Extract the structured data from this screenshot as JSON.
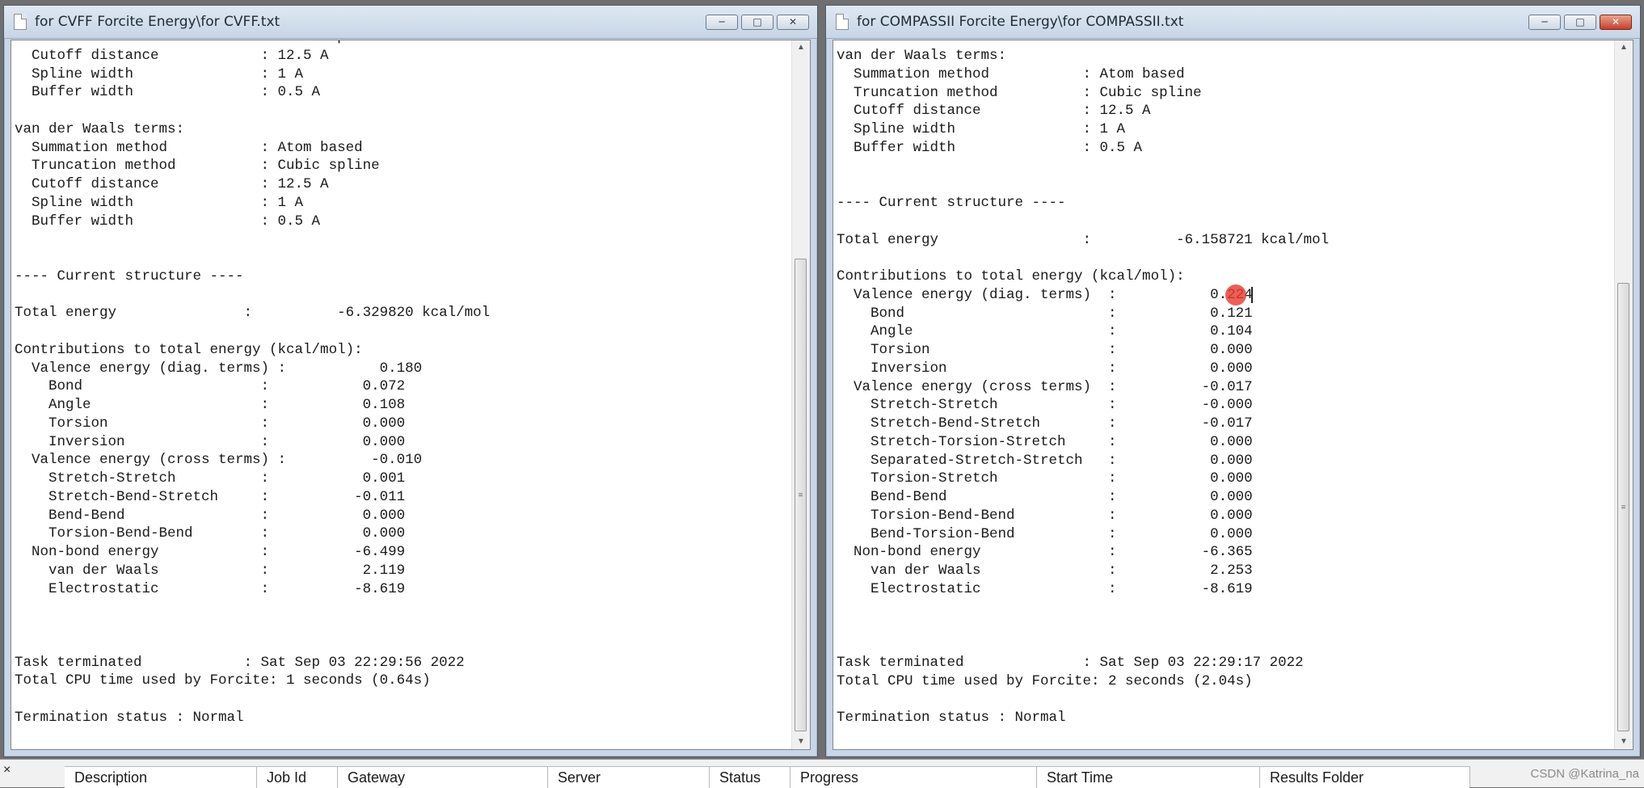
{
  "left_window": {
    "title": "for CVFF Forcite Energy\\for CVFF.txt",
    "text": "  Truncation method          : Cubic spline\n  Cutoff distance            : 12.5 A\n  Spline width               : 1 A\n  Buffer width               : 0.5 A\n\nvan der Waals terms:\n  Summation method           : Atom based\n  Truncation method          : Cubic spline\n  Cutoff distance            : 12.5 A\n  Spline width               : 1 A\n  Buffer width               : 0.5 A\n\n\n---- Current structure ----\n\nTotal energy               :          -6.329820 kcal/mol\n\nContributions to total energy (kcal/mol):\n  Valence energy (diag. terms) :           0.180\n    Bond                     :           0.072\n    Angle                    :           0.108\n    Torsion                  :           0.000\n    Inversion                :           0.000\n  Valence energy (cross terms) :          -0.010\n    Stretch-Stretch          :           0.001\n    Stretch-Bend-Stretch     :          -0.011\n    Bend-Bend                :           0.000\n    Torsion-Bend-Bend        :           0.000\n  Non-bond energy            :          -6.499\n    van der Waals            :           2.119\n    Electrostatic            :          -8.619\n\n\n\nTask terminated            : Sat Sep 03 22:29:56 2022\nTotal CPU time used by Forcite: 1 seconds (0.64s)\n\nTermination status : Normal"
  },
  "right_window": {
    "title": "for COMPASSII Forcite Energy\\for COMPASSII.txt",
    "text": "van der Waals terms:\n  Summation method           : Atom based\n  Truncation method          : Cubic spline\n  Cutoff distance            : 12.5 A\n  Spline width               : 1 A\n  Buffer width               : 0.5 A\n\n\n---- Current structure ----\n\nTotal energy                 :          -6.158721 kcal/mol\n\nContributions to total energy (kcal/mol):\n  Valence energy (diag. terms)  :           0.224\n    Bond                        :           0.121\n    Angle                       :           0.104\n    Torsion                     :           0.000\n    Inversion                   :           0.000\n  Valence energy (cross terms)  :          -0.017\n    Stretch-Stretch             :          -0.000\n    Stretch-Bend-Stretch        :          -0.017\n    Stretch-Torsion-Stretch     :           0.000\n    Separated-Stretch-Stretch   :           0.000\n    Torsion-Stretch             :           0.000\n    Bend-Bend                   :           0.000\n    Torsion-Bend-Bend           :           0.000\n    Bend-Torsion-Bend           :           0.000\n  Non-bond energy               :          -6.365\n    van der Waals               :           2.253\n    Electrostatic               :          -8.619\n\n\n\nTask terminated              : Sat Sep 03 22:29:17 2022\nTotal CPU time used by Forcite: 2 seconds (2.04s)\n\nTermination status : Normal"
  },
  "window_controls": {
    "minimize_icon": "minimize-icon",
    "maximize_icon": "maximize-icon",
    "close_icon": "close-icon"
  },
  "job_table": {
    "close_glyph": "×",
    "columns": [
      "Description",
      "Job Id",
      "Gateway",
      "Server",
      "Status",
      "Progress",
      "Start Time",
      "Results Folder"
    ]
  },
  "watermark": "CSDN @Katrina_na",
  "colors": {
    "title_bar": "#c9d6e6",
    "close_button": "#c4402b",
    "cursor_highlight": "#e63c32"
  }
}
